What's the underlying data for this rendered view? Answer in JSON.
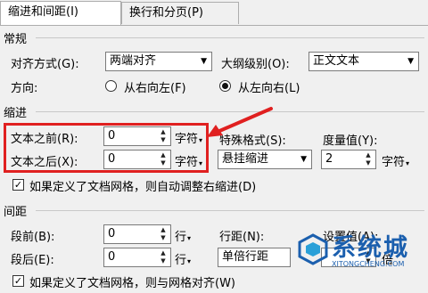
{
  "tabs": [
    "缩进和间距(I)",
    "换行和分页(P)"
  ],
  "general": {
    "title": "常规",
    "alignment_label": "对齐方式(G):",
    "alignment_value": "两端对齐",
    "outline_label": "大纲级别(O):",
    "outline_value": "正文文本",
    "direction_label": "方向:",
    "rtl_label": "从右向左(F)",
    "ltr_label": "从左向右(L)",
    "direction_selected": "ltr"
  },
  "indent": {
    "title": "缩进",
    "before_label": "文本之前(R):",
    "before_value": "0",
    "before_unit": "字符",
    "after_label": "文本之后(X):",
    "after_value": "0",
    "after_unit": "字符",
    "special_label": "特殊格式(S):",
    "special_value": "悬挂缩进",
    "measure_label": "度量值(Y):",
    "measure_value": "2",
    "measure_unit": "字符",
    "grid_check_label": "如果定义了文档网格，则自动调整右缩进(D)",
    "grid_check_checked": true
  },
  "spacing": {
    "title": "间距",
    "before_label": "段前(B):",
    "before_value": "0",
    "before_unit": "行",
    "after_label": "段后(E):",
    "after_value": "0",
    "after_unit": "行",
    "line_label": "行距(N):",
    "line_value": "单倍行距",
    "setting_label": "设置值(A):",
    "setting_unit": "倍",
    "grid_check_label": "如果定义了文档网格，则与网格对齐(W)",
    "grid_check_checked": true
  },
  "watermark": {
    "text": "系统城",
    "url": "XITONGCHENG.COM"
  },
  "colors": {
    "highlight": "#e02020",
    "watermark": "#1b5fae"
  },
  "icons": {
    "dropdown": "chevron-down-icon",
    "spinner": "spinner-arrows-icon",
    "checkbox": "checkmark-icon",
    "arrow": "red-pointer-arrow"
  }
}
